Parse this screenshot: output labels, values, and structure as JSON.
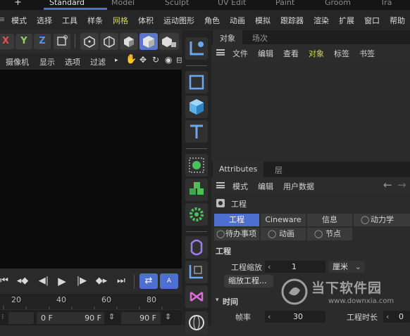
{
  "layout_tabs": {
    "plus": "+",
    "items": [
      "Standard",
      "Model",
      "Sculpt",
      "UV Edit",
      "Paint",
      "Groom",
      "Tra"
    ]
  },
  "menubar": [
    "模式",
    "选择",
    "工具",
    "样条",
    "网格",
    "体积",
    "运动图形",
    "角色",
    "动画",
    "模拟",
    "跟踪器",
    "渲染",
    "扩展",
    "窗口",
    "帮助"
  ],
  "axis_toolbar": {
    "x": "X",
    "y": "Y",
    "z": "Z"
  },
  "viewport_menu": [
    "摄像机",
    "显示",
    "选项",
    "过滤"
  ],
  "ruler": [
    "20",
    "40",
    "60",
    "80"
  ],
  "range": {
    "start": "0 F",
    "end": "90 F",
    "end2": "90 F"
  },
  "object_panel": {
    "tabs": [
      "对象",
      "场次"
    ],
    "menu": [
      "文件",
      "编辑",
      "查看",
      "对象",
      "标签",
      "书签"
    ]
  },
  "attributes": {
    "tabs": [
      "Attributes",
      "层"
    ],
    "menu": [
      "模式",
      "编辑",
      "用户数据"
    ],
    "title": "工程",
    "tabs_row1": [
      "工程",
      "Cineware",
      "信息",
      "动力学"
    ],
    "tabs_row2": [
      "待办事项",
      "动画",
      "节点"
    ],
    "section": "工程",
    "scale_label": "工程缩放",
    "scale_value": "1",
    "unit": "厘米",
    "scale_button": "缩放工程...",
    "time_section": "时间",
    "fps_label": "帧率",
    "fps_value": "30",
    "duration_label": "工程时长",
    "duration_value": "0"
  },
  "watermark": {
    "name": "当下软件园",
    "url": "www.downxia.com"
  },
  "colors": {
    "accent": "#4d6fcf",
    "highlight_menu": "#cfd65a",
    "x_axis": "#e05050",
    "y_axis": "#8fd060",
    "z_axis": "#5a8fe0"
  }
}
